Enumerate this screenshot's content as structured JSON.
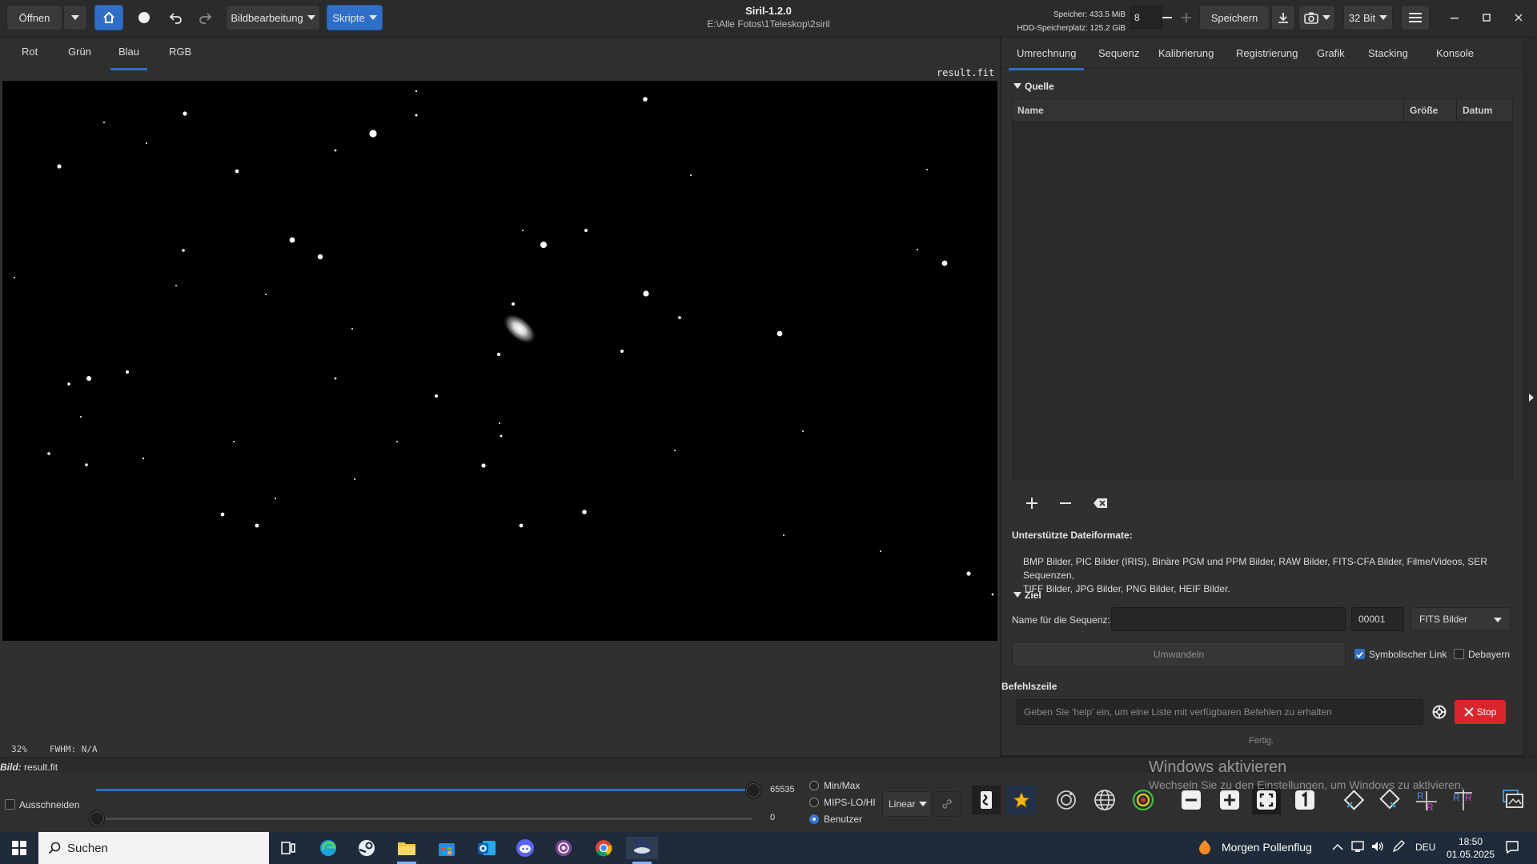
{
  "header": {
    "open_label": "Öffnen",
    "image_processing_label": "Bildbearbeitung",
    "scripts_label": "Skripte",
    "app_title": "Siril-1.2.0",
    "app_path": "E:\\Alle Fotos\\1Teleskop\\2siril",
    "memory_text": "Speicher: 433.5 MiB",
    "disk_text": "HDD-Speicherplatz: 125.2 GiB",
    "threads_value": "8",
    "save_label": "Speichern",
    "bit_depth_label": "32 Bit"
  },
  "channels": {
    "tabs": [
      "Rot",
      "Grün",
      "Blau",
      "RGB"
    ],
    "active": "Blau"
  },
  "viewer": {
    "image_name": "result.fit",
    "zoom": "32%",
    "fwhm": "FWHM: N/A",
    "background": "#000000"
  },
  "right_panel": {
    "tabs": [
      "Umrechnung",
      "Sequenz",
      "Kalibrierung",
      "Registrierung",
      "Grafik",
      "Stacking",
      "Konsole"
    ],
    "active_tab": "Umrechnung",
    "source_section": "Quelle",
    "columns": [
      "Name",
      "Größe",
      "Datum"
    ],
    "supported_formats_title": "Unterstützte Dateiformate:",
    "supported_formats_line1": "BMP Bilder, PIC Bilder (IRIS), Binäre PGM und PPM Bilder, RAW Bilder, FITS-CFA Bilder, Filme/Videos, SER Sequenzen,",
    "supported_formats_line2": "TIFF Bilder, JPG Bilder, PNG Bilder, HEIF Bilder.",
    "target_section": "Ziel",
    "sequence_name_label": "Name für die Sequenz:",
    "sequence_name_value": "",
    "start_index": "00001",
    "output_format": "FITS Bilder",
    "convert_label": "Umwandeln",
    "symlink_label": "Symbolischer Link",
    "symlink_checked": true,
    "debayer_label": "Debayern",
    "debayer_checked": false,
    "command_line_title": "Befehlszeile",
    "command_placeholder": "Geben Sie 'help' ein, um eine Liste mit verfügbaren Befehlen zu erhalten",
    "stop_label": "Stop",
    "status_text": "Fertig."
  },
  "bottom": {
    "image_label": "Bild:",
    "image_value": "result.fit",
    "crop_label": "Ausschneiden",
    "crop_checked": false,
    "high_value": "65535",
    "low_value": "0",
    "high_fraction": 1.0,
    "low_fraction": 0.0,
    "modes": [
      "Min/Max",
      "MIPS-LO/HI",
      "Benutzer"
    ],
    "active_mode": "Benutzer",
    "stretch_label": "Linear"
  },
  "watermark": {
    "title": "Windows aktivieren",
    "subtitle": "Wechseln Sie zu den Einstellungen, um Windows zu aktivieren."
  },
  "taskbar": {
    "search_placeholder": "Suchen",
    "weather_text": "Morgen Pollenflug",
    "language": "DEU",
    "time": "18:50",
    "date": "01.05.2025"
  },
  "colors": {
    "accent": "#2f6ec6",
    "stop_red": "#d9262c",
    "panel_bg": "#303030"
  }
}
